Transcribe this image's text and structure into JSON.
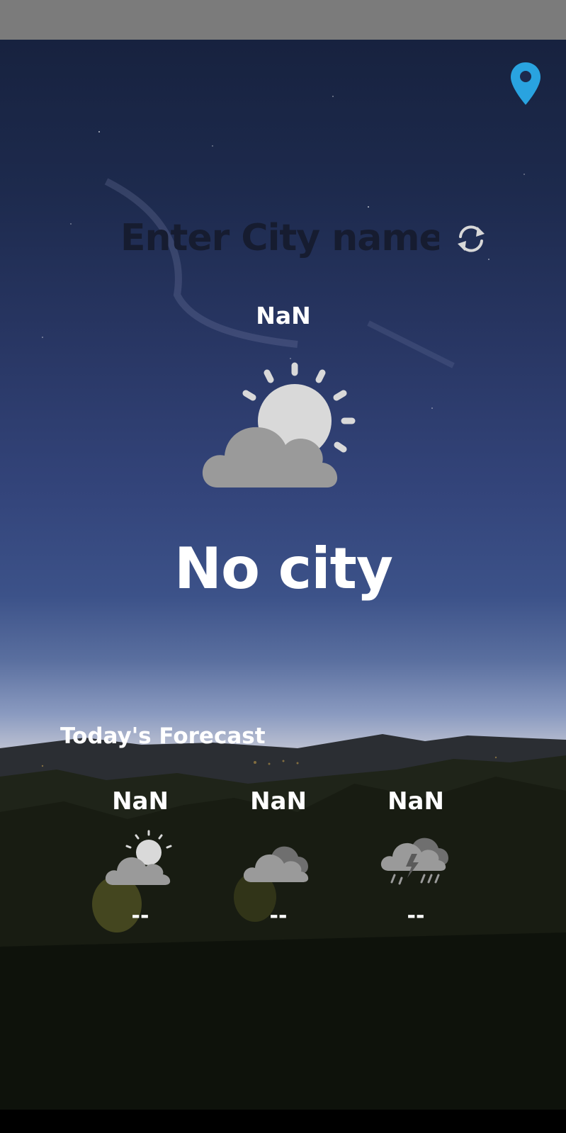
{
  "search": {
    "placeholder": "Enter City name",
    "value": ""
  },
  "current": {
    "date": "NaN",
    "city": "No city",
    "icon": "partly-cloudy-icon"
  },
  "forecast": {
    "title": "Today's Forecast",
    "items": [
      {
        "time": "NaN",
        "temp": "--",
        "icon": "partly-cloudy-icon"
      },
      {
        "time": "NaN",
        "temp": "--",
        "icon": "cloudy-icon"
      },
      {
        "time": "NaN",
        "temp": "--",
        "icon": "thunderstorm-icon"
      }
    ]
  },
  "colors": {
    "status_bar": "#7b7b7b",
    "location_pin": "#29a3e0",
    "icon_cloud": "#9a9a9a",
    "icon_sun": "#d9d9d9",
    "text": "#ffffff"
  }
}
